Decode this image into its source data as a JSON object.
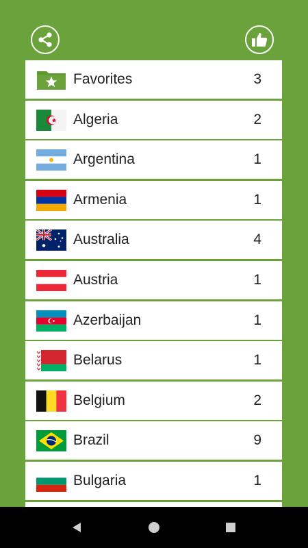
{
  "colors": {
    "background": "#6aa23b",
    "row": "#ffffff",
    "text": "#222222",
    "navbar": "#000000"
  },
  "toolbar": {
    "share_icon": "share-icon",
    "like_icon": "thumbs-up-icon"
  },
  "countries": [
    {
      "name": "Favorites",
      "count": "3",
      "icon": "favorites-folder-star-icon"
    },
    {
      "name": "Algeria",
      "count": "2",
      "icon": "algeria-flag-icon"
    },
    {
      "name": "Argentina",
      "count": "1",
      "icon": "argentina-flag-icon"
    },
    {
      "name": "Armenia",
      "count": "1",
      "icon": "armenia-flag-icon"
    },
    {
      "name": "Australia",
      "count": "4",
      "icon": "australia-flag-icon"
    },
    {
      "name": "Austria",
      "count": "1",
      "icon": "austria-flag-icon"
    },
    {
      "name": "Azerbaijan",
      "count": "1",
      "icon": "azerbaijan-flag-icon"
    },
    {
      "name": "Belarus",
      "count": "1",
      "icon": "belarus-flag-icon"
    },
    {
      "name": "Belgium",
      "count": "2",
      "icon": "belgium-flag-icon"
    },
    {
      "name": "Brazil",
      "count": "9",
      "icon": "brazil-flag-icon"
    },
    {
      "name": "Bulgaria",
      "count": "1",
      "icon": "bulgaria-flag-icon"
    }
  ],
  "navbar": {
    "back_icon": "back-triangle-icon",
    "home_icon": "home-circle-icon",
    "recents_icon": "recents-square-icon"
  }
}
